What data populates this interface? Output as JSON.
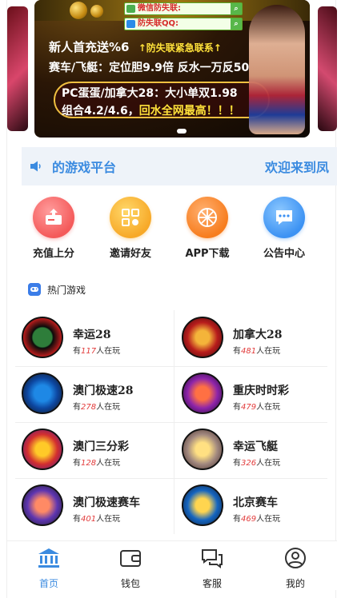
{
  "banner": {
    "contact_wechat": "微信防失联:",
    "contact_qq": "防失联QQ:",
    "line1_a": "新人首充送%6",
    "line1_b": "↑防失联紧急联系↑",
    "line2": "赛车/飞艇：定位胆9.9倍 反水一万反50",
    "line3": "PC蛋蛋/加拿大28：大小单双1.98",
    "line4_a": "组合4.2/4.6，",
    "line4_b": "回水全网最高！！！"
  },
  "notice": {
    "text_left": "的游戏平台",
    "text_right": "欢迎来到凤"
  },
  "quick_actions": [
    {
      "label": "充值上分"
    },
    {
      "label": "邀请好友"
    },
    {
      "label": "APP下载"
    },
    {
      "label": "公告中心"
    }
  ],
  "hot_games": {
    "title": "热门游戏",
    "prefix": "有",
    "suffix": "人在玩",
    "items": [
      {
        "name": "幸运28",
        "players": "117"
      },
      {
        "name": "加拿大28",
        "players": "481"
      },
      {
        "name": "澳门极速28",
        "players": "278"
      },
      {
        "name": "重庆时时彩",
        "players": "479"
      },
      {
        "name": "澳门三分彩",
        "players": "128"
      },
      {
        "name": "幸运飞艇",
        "players": "326"
      },
      {
        "name": "澳门极速赛车",
        "players": "401"
      },
      {
        "name": "北京赛车",
        "players": "469"
      }
    ]
  },
  "tabbar": [
    {
      "label": "首页",
      "icon": "bank-icon",
      "active": true
    },
    {
      "label": "钱包",
      "icon": "wallet-icon",
      "active": false
    },
    {
      "label": "客服",
      "icon": "chat-icon",
      "active": false
    },
    {
      "label": "我的",
      "icon": "user-icon",
      "active": false
    }
  ],
  "colors": {
    "accent": "#3b8be0",
    "player_count": "#e23c3c"
  }
}
